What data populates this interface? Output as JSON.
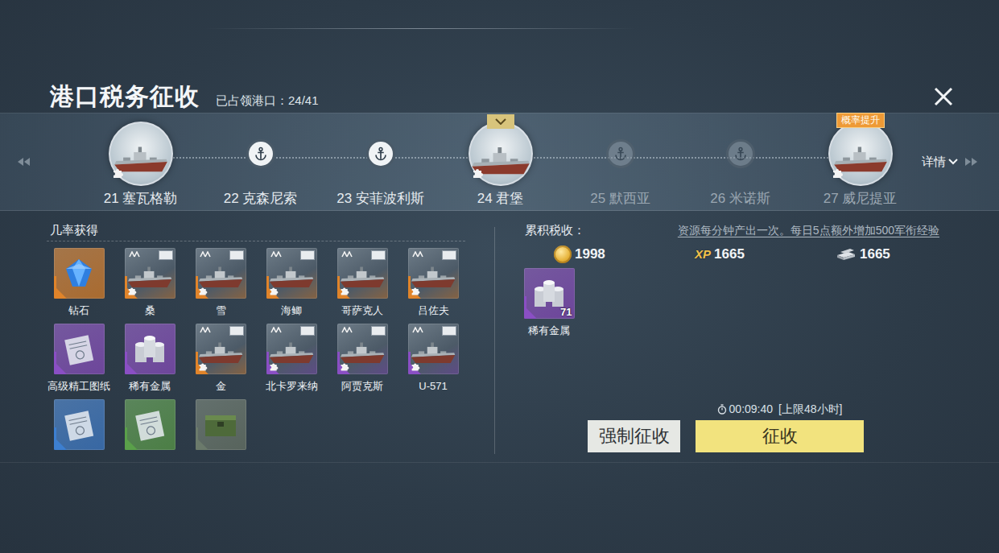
{
  "header": {
    "title": "港口税务征收",
    "occupied": "已占领港口：24/41"
  },
  "ports": [
    {
      "label": "21 塞瓦格勒",
      "kind": "ship",
      "selected": false,
      "locked": false
    },
    {
      "label": "22 克森尼索",
      "kind": "anchor",
      "selected": false,
      "locked": false
    },
    {
      "label": "23 安菲波利斯",
      "kind": "anchor",
      "selected": false,
      "locked": false
    },
    {
      "label": "24 君堡",
      "kind": "ship",
      "selected": true,
      "locked": false
    },
    {
      "label": "25 默西亚",
      "kind": "anchor",
      "selected": false,
      "locked": true
    },
    {
      "label": "26 米诺斯",
      "kind": "anchor",
      "selected": false,
      "locked": true
    },
    {
      "label": "27 威尼提亚",
      "kind": "ship",
      "selected": false,
      "locked": true,
      "badge": "概率提升"
    }
  ],
  "details": "详情",
  "drops": {
    "title": "几率获得",
    "items": [
      {
        "name": "钻石",
        "kind": "diamond",
        "color": "#e0842a"
      },
      {
        "name": "桑",
        "kind": "ship",
        "color": "#e0842a"
      },
      {
        "name": "雪",
        "kind": "ship",
        "color": "#e0842a"
      },
      {
        "name": "海鲫",
        "kind": "ship",
        "color": "#e0842a"
      },
      {
        "name": "哥萨克人",
        "kind": "ship",
        "color": "#e0842a"
      },
      {
        "name": "吕佐夫",
        "kind": "ship",
        "color": "#e0842a"
      },
      {
        "name": "高级精工图纸",
        "kind": "blueprint",
        "color": "#8a4fc4"
      },
      {
        "name": "稀有金属",
        "kind": "metal",
        "color": "#8a4fc4"
      },
      {
        "name": "金",
        "kind": "ship",
        "color": "#e0842a"
      },
      {
        "name": "北卡罗来纳",
        "kind": "ship",
        "color": "#8a4fc4"
      },
      {
        "name": "阿贾克斯",
        "kind": "ship",
        "color": "#8a4fc4"
      },
      {
        "name": "U-571",
        "kind": "ship",
        "color": "#8a4fc4"
      },
      {
        "kind": "blueprint",
        "color": "#3d7fd0"
      },
      {
        "kind": "blueprint",
        "color": "#5aa04a"
      },
      {
        "kind": "crate",
        "color": "#6b7a6b"
      }
    ]
  },
  "tax": {
    "title": "累积税收：",
    "note": "资源每分钟产出一次。每日5点额外增加500军衔经验",
    "resources": [
      {
        "kind": "coin",
        "amount": "1998"
      },
      {
        "kind": "xp",
        "amount": "1665",
        "icon_text": "XP"
      },
      {
        "kind": "steel",
        "amount": "1665"
      }
    ],
    "items": [
      {
        "name": "稀有金属",
        "count": "71",
        "kind": "metal",
        "color": "#8a4fc4"
      }
    ]
  },
  "timer": {
    "value": "00:09:40",
    "limit": "[上限48小时]"
  },
  "buttons": [
    {
      "label": "强制征收",
      "kind": "secondary"
    },
    {
      "label": "征收",
      "kind": "primary"
    }
  ]
}
